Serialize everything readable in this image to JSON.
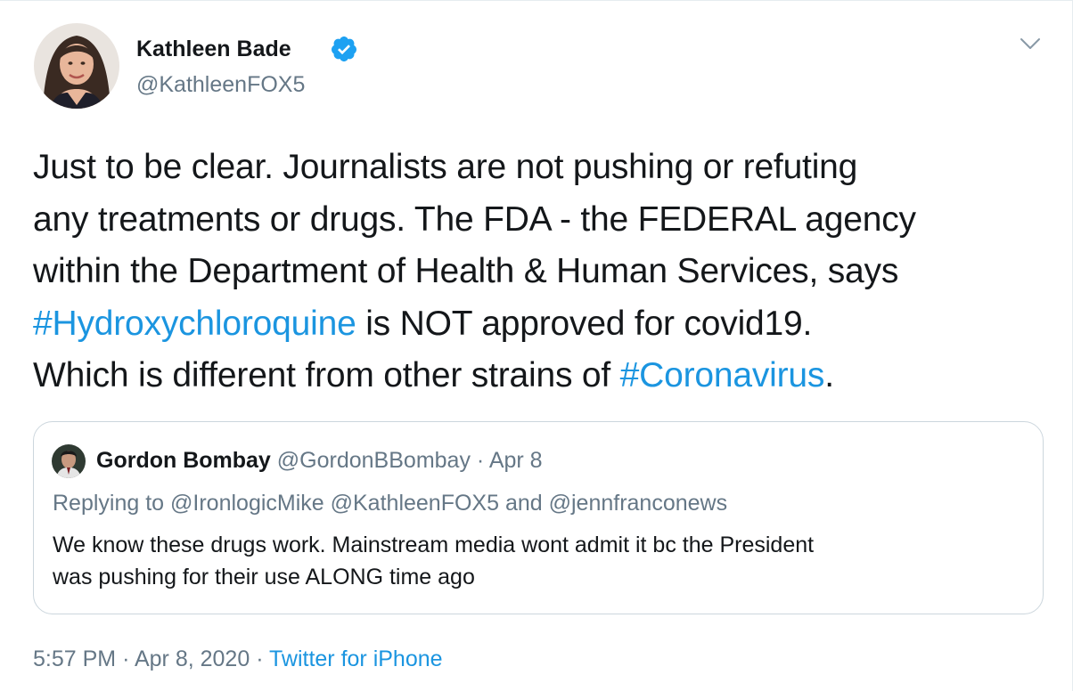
{
  "author": {
    "name": "Kathleen Bade",
    "handle": "@KathleenFOX5",
    "verified": true,
    "avatar_icon": "profile-photo"
  },
  "tweet": {
    "lines": [
      [
        {
          "text": "Just to be clear. Journalists are not pushing or refuting",
          "type": "text"
        }
      ],
      [
        {
          "text": "any treatments or drugs. The FDA - the FEDERAL agency",
          "type": "text"
        }
      ],
      [
        {
          "text": "within the Department of Health & Human Services, says",
          "type": "text"
        }
      ],
      [
        {
          "text": "#Hydroxychloroquine",
          "type": "hashtag"
        },
        {
          "text": " is NOT approved for covid19.",
          "type": "text"
        }
      ],
      [
        {
          "text": "Which is different from other strains of ",
          "type": "text"
        },
        {
          "text": "#Coronavirus",
          "type": "hashtag"
        },
        {
          "text": ".",
          "type": "text"
        }
      ]
    ]
  },
  "quoted": {
    "name": "Gordon Bombay",
    "handle": "@GordonBBombay",
    "separator": "·",
    "date": "Apr 8",
    "replying_prefix": "Replying to",
    "replying_to": "@IronlogicMike @KathleenFOX5 and @jennfranconews",
    "text_lines": [
      "We know these drugs work. Mainstream media wont admit it bc the President",
      "was pushing for their use ALONG time ago"
    ]
  },
  "meta": {
    "time": "5:57 PM",
    "date": "Apr 8, 2020",
    "separator": "·",
    "source": "Twitter for iPhone"
  },
  "colors": {
    "link": "#1b95e0",
    "secondary_text": "#657786",
    "primary_text": "#14171a",
    "border": "#ccd6dd",
    "verified_badge": "#1da1f2"
  },
  "icons": {
    "verified": "verified-badge-icon",
    "more": "chevron-down-icon"
  }
}
